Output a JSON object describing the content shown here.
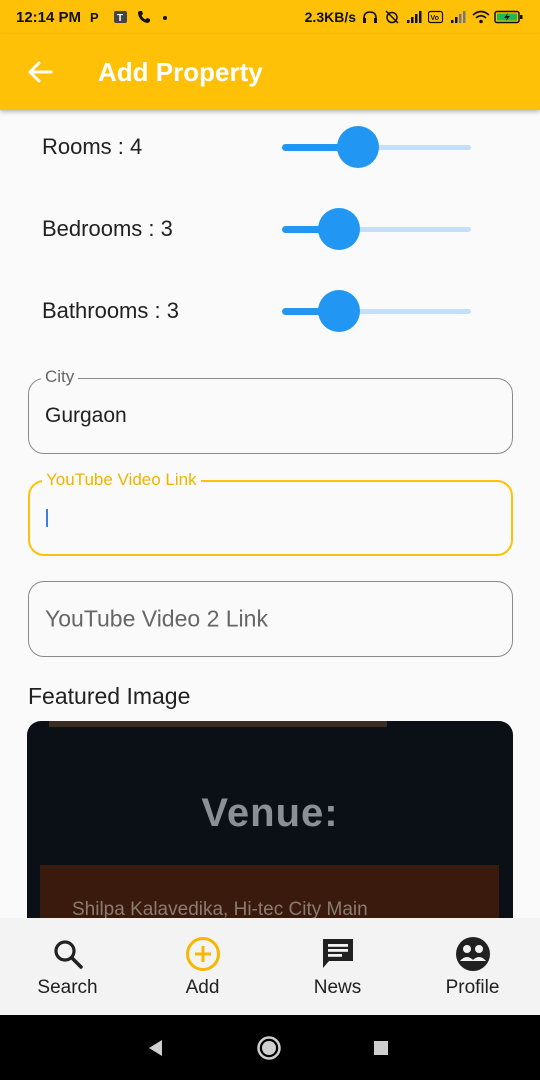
{
  "status_bar": {
    "time": "12:14 PM",
    "network_speed": "2.3KB/s",
    "battery_level": 1.0
  },
  "app_bar": {
    "title": "Add Property"
  },
  "sliders": [
    {
      "label": "Rooms : 4",
      "value": 4,
      "fraction": 0.4
    },
    {
      "label": "Bedrooms : 3",
      "value": 3,
      "fraction": 0.3
    },
    {
      "label": "Bathrooms : 3",
      "value": 3,
      "fraction": 0.3
    }
  ],
  "fields": {
    "city": {
      "label": "City",
      "value": "Gurgaon"
    },
    "youtube_link": {
      "label": "YouTube Video Link",
      "value": ""
    },
    "youtube_link_2": {
      "placeholder": "YouTube Video 2 Link"
    }
  },
  "featured_image": {
    "section_title": "Featured Image",
    "heading": "Venue:",
    "address": "Shilpa Kalavedika, Hi-tec City Main"
  },
  "bottom_nav": [
    {
      "label": "Search",
      "icon": "search-icon"
    },
    {
      "label": "Add",
      "icon": "add-circle-icon"
    },
    {
      "label": "News",
      "icon": "chat-icon"
    },
    {
      "label": "Profile",
      "icon": "group-icon"
    }
  ],
  "colors": {
    "accent": "#ffc107",
    "slider": "#2196f3",
    "add_icon": "#f5b800"
  }
}
